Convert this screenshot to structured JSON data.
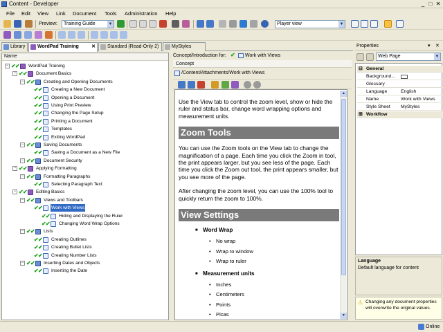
{
  "window": {
    "title": "Content - Developer"
  },
  "menu": [
    "File",
    "Edit",
    "View",
    "Link",
    "Document",
    "Tools",
    "Administration",
    "Help"
  ],
  "toolbar": {
    "preview_label": "Preview:",
    "preview_value": "Training Guide",
    "player_value": "Player view"
  },
  "tabs": [
    {
      "label": "Library"
    },
    {
      "label": "WordPad Training"
    },
    {
      "label": "Standard (Read-Only 2)"
    },
    {
      "label": "MyStyles"
    }
  ],
  "tree": {
    "header": "Name",
    "nodes": [
      {
        "label": "WordPad Training",
        "indent": 0
      },
      {
        "label": "Document Basics",
        "indent": 1
      },
      {
        "label": "Creating and Opening Documents",
        "indent": 2
      },
      {
        "label": "Creating a New Document",
        "indent": 3
      },
      {
        "label": "Opening a Document",
        "indent": 3
      },
      {
        "label": "Using Print Preview",
        "indent": 3
      },
      {
        "label": "Changing the Page Setup",
        "indent": 3
      },
      {
        "label": "Printing a Document",
        "indent": 3
      },
      {
        "label": "Templates",
        "indent": 3
      },
      {
        "label": "Exiting WordPad",
        "indent": 3
      },
      {
        "label": "Saving Documents",
        "indent": 2
      },
      {
        "label": "Saving a Document as a New File",
        "indent": 3
      },
      {
        "label": "Document Security",
        "indent": 2
      },
      {
        "label": "Applying Formatting",
        "indent": 1
      },
      {
        "label": "Formatting Paragraphs",
        "indent": 2
      },
      {
        "label": "Selecting Paragraph Text",
        "indent": 3
      },
      {
        "label": "Editing Basics",
        "indent": 1
      },
      {
        "label": "Views and Toolbars",
        "indent": 2
      },
      {
        "label": "Work with Views",
        "indent": 3
      },
      {
        "label": "Hiding and Displaying the Ruler",
        "indent": 4
      },
      {
        "label": "Changing Word Wrap Options",
        "indent": 4
      },
      {
        "label": "Lists",
        "indent": 2
      },
      {
        "label": "Creating Outlines",
        "indent": 3
      },
      {
        "label": "Creating Bullet Lists",
        "indent": 3
      },
      {
        "label": "Creating Number Lists",
        "indent": 3
      },
      {
        "label": "Inserting Dates and Objects",
        "indent": 2
      },
      {
        "label": "Inserting the Date",
        "indent": 3
      }
    ]
  },
  "content": {
    "intro_label": "Concept/Introduction for:",
    "intro_value": "Work with Views",
    "concept_label": "Concept",
    "path": "/Content/Attachments/Work with Views",
    "doc": {
      "p1": "Use the View tab to control the zoom level, show or hide the ruler and status bar, change word wrapping options and measurement units.",
      "h1": "Zoom Tools",
      "p2": "You can use the Zoom tools on the View tab to change the magnification of a page. Each time you click the Zoom in tool, the print appears larger, but you see less of the page. Each time you click the Zoom out tool, the print appears smaller, but you see more of the page.",
      "p3": "After changing the zoom level, you can use the 100% tool to quickly return the zoom to 100%.",
      "h2": "View Settings",
      "b1": "Word Wrap",
      "b1a": "No wrap",
      "b1b": "Wrap to window",
      "b1c": "Wrap to ruler",
      "b2": "Measurement units",
      "b2a": "Inches",
      "b2b": "Centimeters",
      "b2c": "Points",
      "b2d": "Picas"
    }
  },
  "properties": {
    "title": "Properties",
    "dropdown": "Web Page",
    "general": "General",
    "workflow": "Workflow",
    "rows": [
      {
        "k": "Background...",
        "v": ""
      },
      {
        "k": "Glossary",
        "v": ""
      },
      {
        "k": "Language",
        "v": "English"
      },
      {
        "k": "Name",
        "v": "Work with Views"
      },
      {
        "k": "Style Sheet",
        "v": "MyStyles"
      }
    ],
    "help_title": "Language",
    "help_text": "Default language for content",
    "warning": "Changing any document properties will overwrite the original values."
  },
  "status": {
    "text": "Online"
  }
}
